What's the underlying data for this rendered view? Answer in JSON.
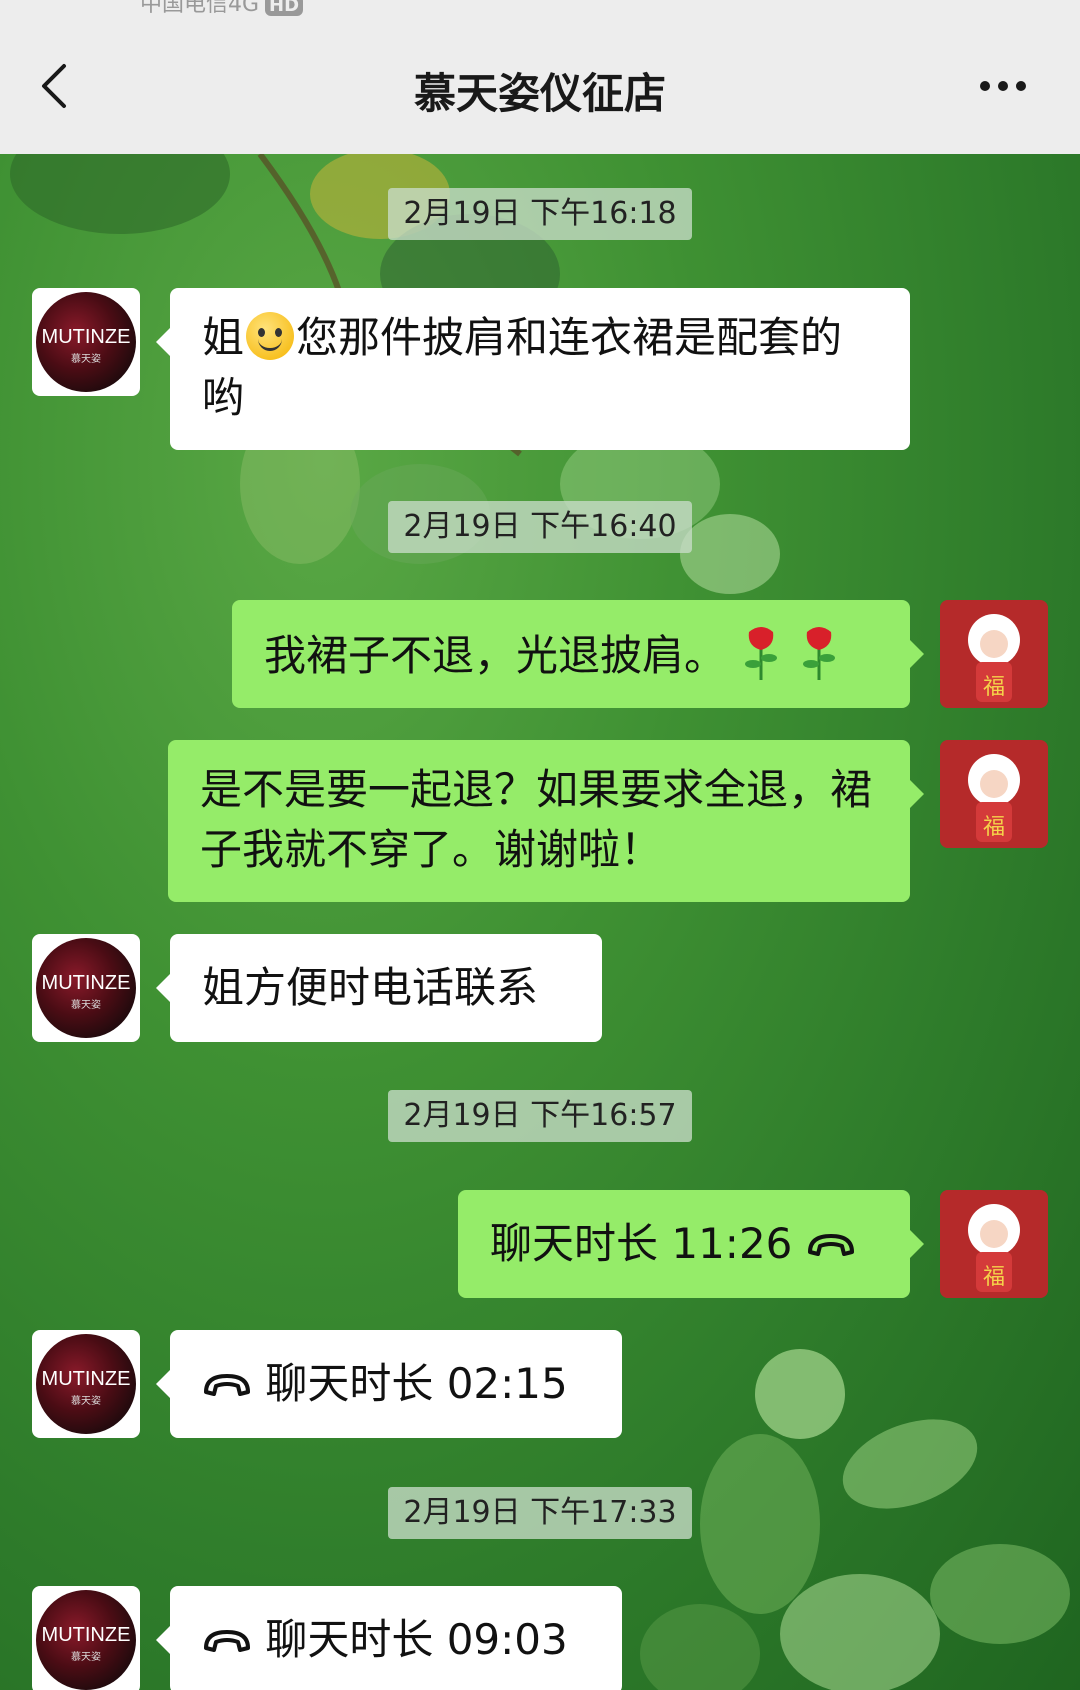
{
  "status_bar": {
    "carrier": "中国电信4G",
    "badge": "HD"
  },
  "header": {
    "title": "慕天姿仪征店"
  },
  "contacts": {
    "shop_avatar_text": "MUTINZE",
    "shop_avatar_sub": "慕天姿"
  },
  "messages": [
    {
      "type": "timestamp",
      "text": "2月19日 下午16:18"
    },
    {
      "type": "incoming",
      "text_before": "姐",
      "emoji": "smile",
      "text_after": "您那件披肩和连衣裙是配套的哟"
    },
    {
      "type": "timestamp",
      "text": "2月19日 下午16:40"
    },
    {
      "type": "outgoing",
      "text": "我裙子不退，光退披肩。",
      "emoji": "rose-x2"
    },
    {
      "type": "outgoing",
      "text": "是不是要一起退？如果要求全退，裙子我就不穿了。谢谢啦！"
    },
    {
      "type": "incoming",
      "text": "姐方便时电话联系"
    },
    {
      "type": "timestamp",
      "text": "2月19日 下午16:57"
    },
    {
      "type": "outgoing",
      "text": "聊天时长 11:26",
      "icon": "phone-icon"
    },
    {
      "type": "incoming",
      "text": "聊天时长 02:15",
      "icon": "phone-icon"
    },
    {
      "type": "timestamp",
      "text": "2月19日 下午17:33"
    },
    {
      "type": "incoming",
      "text": "聊天时长 09:03",
      "icon": "phone-icon"
    }
  ],
  "colors": {
    "incoming_bubble": "#ffffff",
    "outgoing_bubble": "#95ec69",
    "header_bg": "#ededed"
  }
}
